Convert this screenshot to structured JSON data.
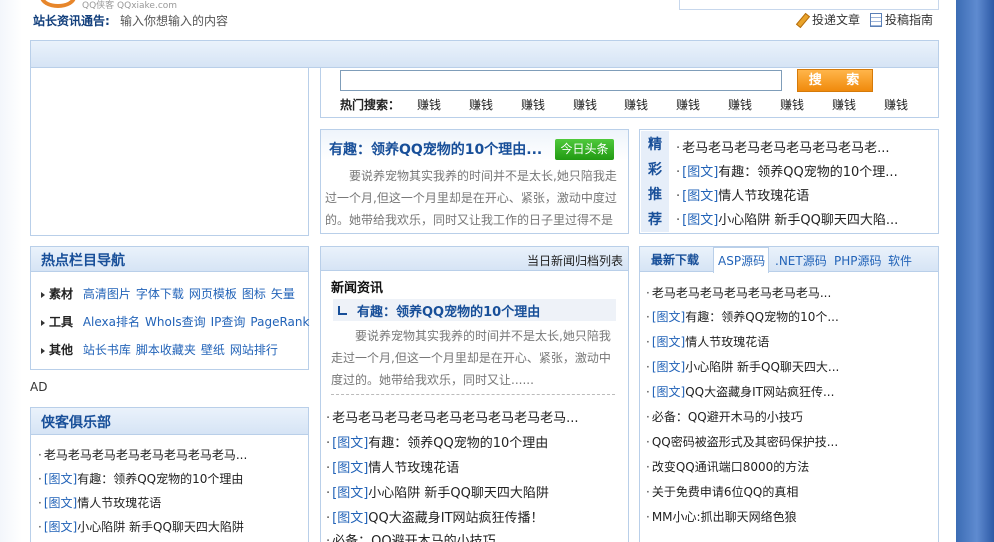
{
  "header": {
    "logo_text": "QQ侠客 QQxiake.com",
    "notice_label": "站长资讯通告:",
    "notice_text": "输入你想输入的内容",
    "submit_link": "投递文章",
    "guide_link": "投稿指南"
  },
  "search": {
    "button": "搜 索",
    "hot_label": "热门搜索：",
    "hot_keywords": [
      "赚钱",
      "赚钱",
      "赚钱",
      "赚钱",
      "赚钱",
      "赚钱",
      "赚钱",
      "赚钱",
      "赚钱",
      "赚钱"
    ]
  },
  "feature": {
    "title": "有趣：领养QQ宠物的10个理由...",
    "badge": "今日头条",
    "body": "要说养宠物其实我养的时间并不是太长,她只陪我走过一个月,但这一个月里却是在开心、紧张，激动中度过的。她带给我欢乐，同时又让我工作的日子里过得不是"
  },
  "jingcai": {
    "tag": [
      "精",
      "彩",
      "推",
      "荐"
    ],
    "items": [
      {
        "tag": "",
        "text": "老马老马老马老马老马老马老马老..."
      },
      {
        "tag": "[图文]",
        "text": "有趣：领养QQ宠物的10个理..."
      },
      {
        "tag": "[图文]",
        "text": "情人节玫瑰花语"
      },
      {
        "tag": "[图文]",
        "text": "小心陷阱 新手QQ聊天四大陷..."
      }
    ]
  },
  "hot_nav": {
    "title": "热点栏目导航",
    "rows": [
      {
        "cat": "素材",
        "links": [
          "高清图片",
          "字体下载",
          "网页模板",
          "图标",
          "矢量"
        ]
      },
      {
        "cat": "工具",
        "links": [
          "Alexa排名",
          "WhoIs查询",
          "IP查询",
          "PageRank"
        ]
      },
      {
        "cat": "其他",
        "links": [
          "站长书库",
          "脚本收藏夹",
          "壁纸",
          "网站排行"
        ]
      }
    ]
  },
  "ad_label": "AD",
  "club": {
    "title": "侠客俱乐部",
    "items": [
      {
        "tag": "",
        "text": "老马老马老马老马老马老马老马老马..."
      },
      {
        "tag": "[图文]",
        "text": "有趣：领养QQ宠物的10个理由"
      },
      {
        "tag": "[图文]",
        "text": "情人节玫瑰花语"
      },
      {
        "tag": "[图文]",
        "text": "小心陷阱 新手QQ聊天四大陷阱"
      }
    ]
  },
  "news": {
    "archive_link": "当日新闻归档列表",
    "section_title": "新闻资讯",
    "lead_title": "有趣：领养QQ宠物的10个理由",
    "summary": "要说养宠物其实我养的时间并不是太长,她只陪我走过一个月,但这一个月里却是在开心、紧张，激动中度过的。她带给我欢乐，同时又让......",
    "items": [
      {
        "tag": "",
        "text": "老马老马老马老马老马老马老马老马老马..."
      },
      {
        "tag": "[图文]",
        "text": "有趣：领养QQ宠物的10个理由"
      },
      {
        "tag": "[图文]",
        "text": "情人节玫瑰花语"
      },
      {
        "tag": "[图文]",
        "text": "小心陷阱 新手QQ聊天四大陷阱"
      },
      {
        "tag": "[图文]",
        "text": "QQ大盗藏身IT网站疯狂传播！"
      },
      {
        "tag": "",
        "text": "必备：QQ避开木马的小技巧"
      }
    ]
  },
  "downloads": {
    "title": "最新下载",
    "tabs": [
      "ASP源码",
      ".NET源码",
      "PHP源码",
      "软件"
    ],
    "items": [
      {
        "tag": "",
        "text": "老马老马老马老马老马老马老马..."
      },
      {
        "tag": "[图文]",
        "text": "有趣：领养QQ宠物的10个..."
      },
      {
        "tag": "[图文]",
        "text": "情人节玫瑰花语"
      },
      {
        "tag": "[图文]",
        "text": "小心陷阱 新手QQ聊天四大..."
      },
      {
        "tag": "[图文]",
        "text": "QQ大盗藏身IT网站疯狂传..."
      },
      {
        "tag": "",
        "text": "必备：QQ避开木马的小技巧"
      },
      {
        "tag": "",
        "text": "QQ密码被盗形式及其密码保护技..."
      },
      {
        "tag": "",
        "text": "改变QQ通讯端口8000的方法"
      },
      {
        "tag": "",
        "text": "关于免费申请6位QQ的真相"
      },
      {
        "tag": "",
        "text": "MM小心:抓出聊天网络色狼"
      }
    ]
  }
}
